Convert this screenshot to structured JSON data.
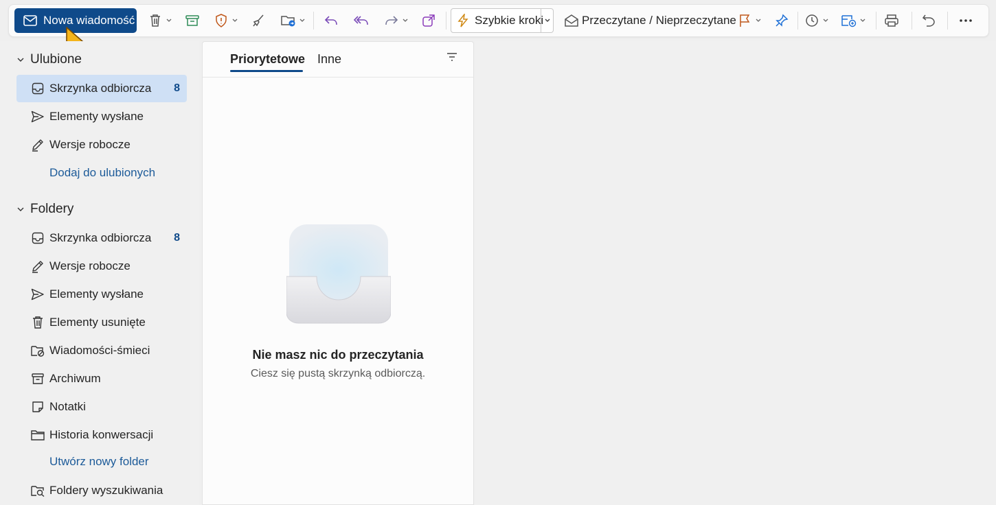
{
  "toolbar": {
    "new_message_label": "Nowa wiadomość",
    "quick_steps_label": "Szybkie kroki",
    "read_unread_label": "Przeczytane / Nieprzeczytane",
    "icons": [
      "mail-icon",
      "delete-icon",
      "archive-icon",
      "report-icon",
      "sweep-icon",
      "move-to-icon",
      "reply-icon",
      "reply-all-icon",
      "forward-icon",
      "share-icon",
      "lightning-icon",
      "envelope-open-icon",
      "flag-icon",
      "pin-icon",
      "snooze-icon",
      "categorize-icon",
      "print-icon",
      "undo-icon",
      "more-icon"
    ]
  },
  "nav": {
    "favorites": {
      "title": "Ulubione",
      "items": [
        {
          "label": "Skrzynka odbiorcza",
          "count": "8",
          "icon": "inbox-icon",
          "selected": true
        },
        {
          "label": "Elementy wysłane",
          "count": "",
          "icon": "send-icon"
        },
        {
          "label": "Wersje robocze",
          "count": "",
          "icon": "drafts-icon"
        }
      ],
      "add_link": "Dodaj do ulubionych"
    },
    "folders": {
      "title": "Foldery",
      "items": [
        {
          "label": "Skrzynka odbiorcza",
          "count": "8",
          "icon": "inbox-icon"
        },
        {
          "label": "Wersje robocze",
          "count": "",
          "icon": "drafts-icon"
        },
        {
          "label": "Elementy wysłane",
          "count": "",
          "icon": "send-icon"
        },
        {
          "label": "Elementy usunięte",
          "count": "",
          "icon": "trash-icon"
        },
        {
          "label": "Wiadomości-śmieci",
          "count": "",
          "icon": "junk-icon"
        },
        {
          "label": "Archiwum",
          "count": "",
          "icon": "archive-icon"
        },
        {
          "label": "Notatki",
          "count": "",
          "icon": "note-icon"
        },
        {
          "label": "Historia konwersacji",
          "count": "",
          "icon": "folder-icon"
        }
      ],
      "create_link": "Utwórz nowy folder",
      "search_folders": {
        "label": "Foldery wyszukiwania",
        "icon": "search-folder-icon"
      }
    }
  },
  "list": {
    "tabs": [
      "Priorytetowe",
      "Inne"
    ],
    "active_tab": "Priorytetowe",
    "empty_title": "Nie masz nic do przeczytania",
    "empty_subtitle": "Ciesz się pustą skrzynką odbiorczą."
  },
  "colors": {
    "accent": "#0f4a8a",
    "selected_bg": "#cfe0f5",
    "archive_green": "#2e8b57",
    "report_orange": "#c0571a",
    "share_purple": "#8a3ab9",
    "reply_purple": "#7a4bb8"
  }
}
